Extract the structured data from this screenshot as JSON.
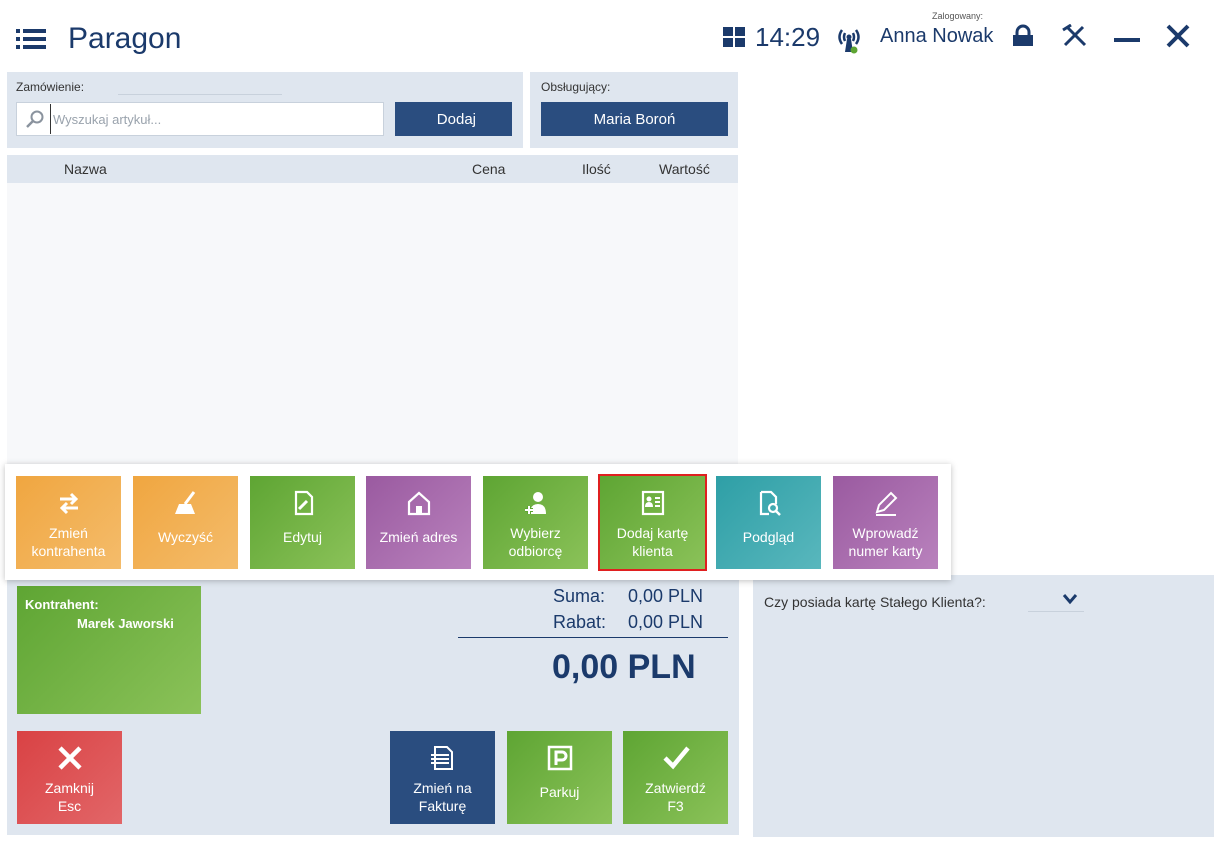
{
  "header": {
    "title": "Paragon",
    "clock": "14:29",
    "logged_label": "Zalogowany:",
    "user_name": "Anna Nowak"
  },
  "order": {
    "label": "Zamówienie:",
    "search_placeholder": "Wyszukaj artykuł...",
    "add_label": "Dodaj"
  },
  "server": {
    "label": "Obsługujący:",
    "name": "Maria Boroń"
  },
  "table": {
    "columns": [
      "Nazwa",
      "Cena",
      "Ilość",
      "Wartość"
    ]
  },
  "actions": [
    {
      "label": "Zmień kontrahenta",
      "icon": "swap-arrows-icon",
      "color": "#f0a640"
    },
    {
      "label": "Wyczyść",
      "icon": "broom-icon",
      "color": "#f0a640"
    },
    {
      "label": "Edytuj",
      "icon": "edit-document-icon",
      "color": "#5ea533"
    },
    {
      "label": "Zmień adres",
      "icon": "home-icon",
      "color": "#9a5aa0"
    },
    {
      "label": "Wybierz odbiorcę",
      "icon": "add-person-icon",
      "color": "#5ea533"
    },
    {
      "label": "Dodaj kartę klienta",
      "icon": "client-card-icon",
      "color": "#5ea533"
    },
    {
      "label": "Podgląd",
      "icon": "preview-document-icon",
      "color": "#2e9fa6"
    },
    {
      "label": "Wprowadź numer karty",
      "icon": "pencil-icon",
      "color": "#9a5aa0"
    }
  ],
  "contractor": {
    "label": "Kontrahent:",
    "name": "Marek Jaworski"
  },
  "totals": {
    "sum_label": "Suma:",
    "sum_value": "0,00 PLN",
    "rebate_label": "Rabat:",
    "rebate_value": "0,00 PLN",
    "total": "0,00 PLN"
  },
  "bottom_buttons": {
    "close": "Zamknij Esc",
    "change_invoice": "Zmień na Fakturę",
    "park": "Parkuj",
    "confirm": "Zatwierdź F3"
  },
  "loyalty": {
    "question": "Czy posiada kartę Stałego Klienta?:"
  },
  "colors": {
    "navy": "#2a4d7f",
    "panel": "#dfe6ef",
    "highlight": "#e02020"
  }
}
